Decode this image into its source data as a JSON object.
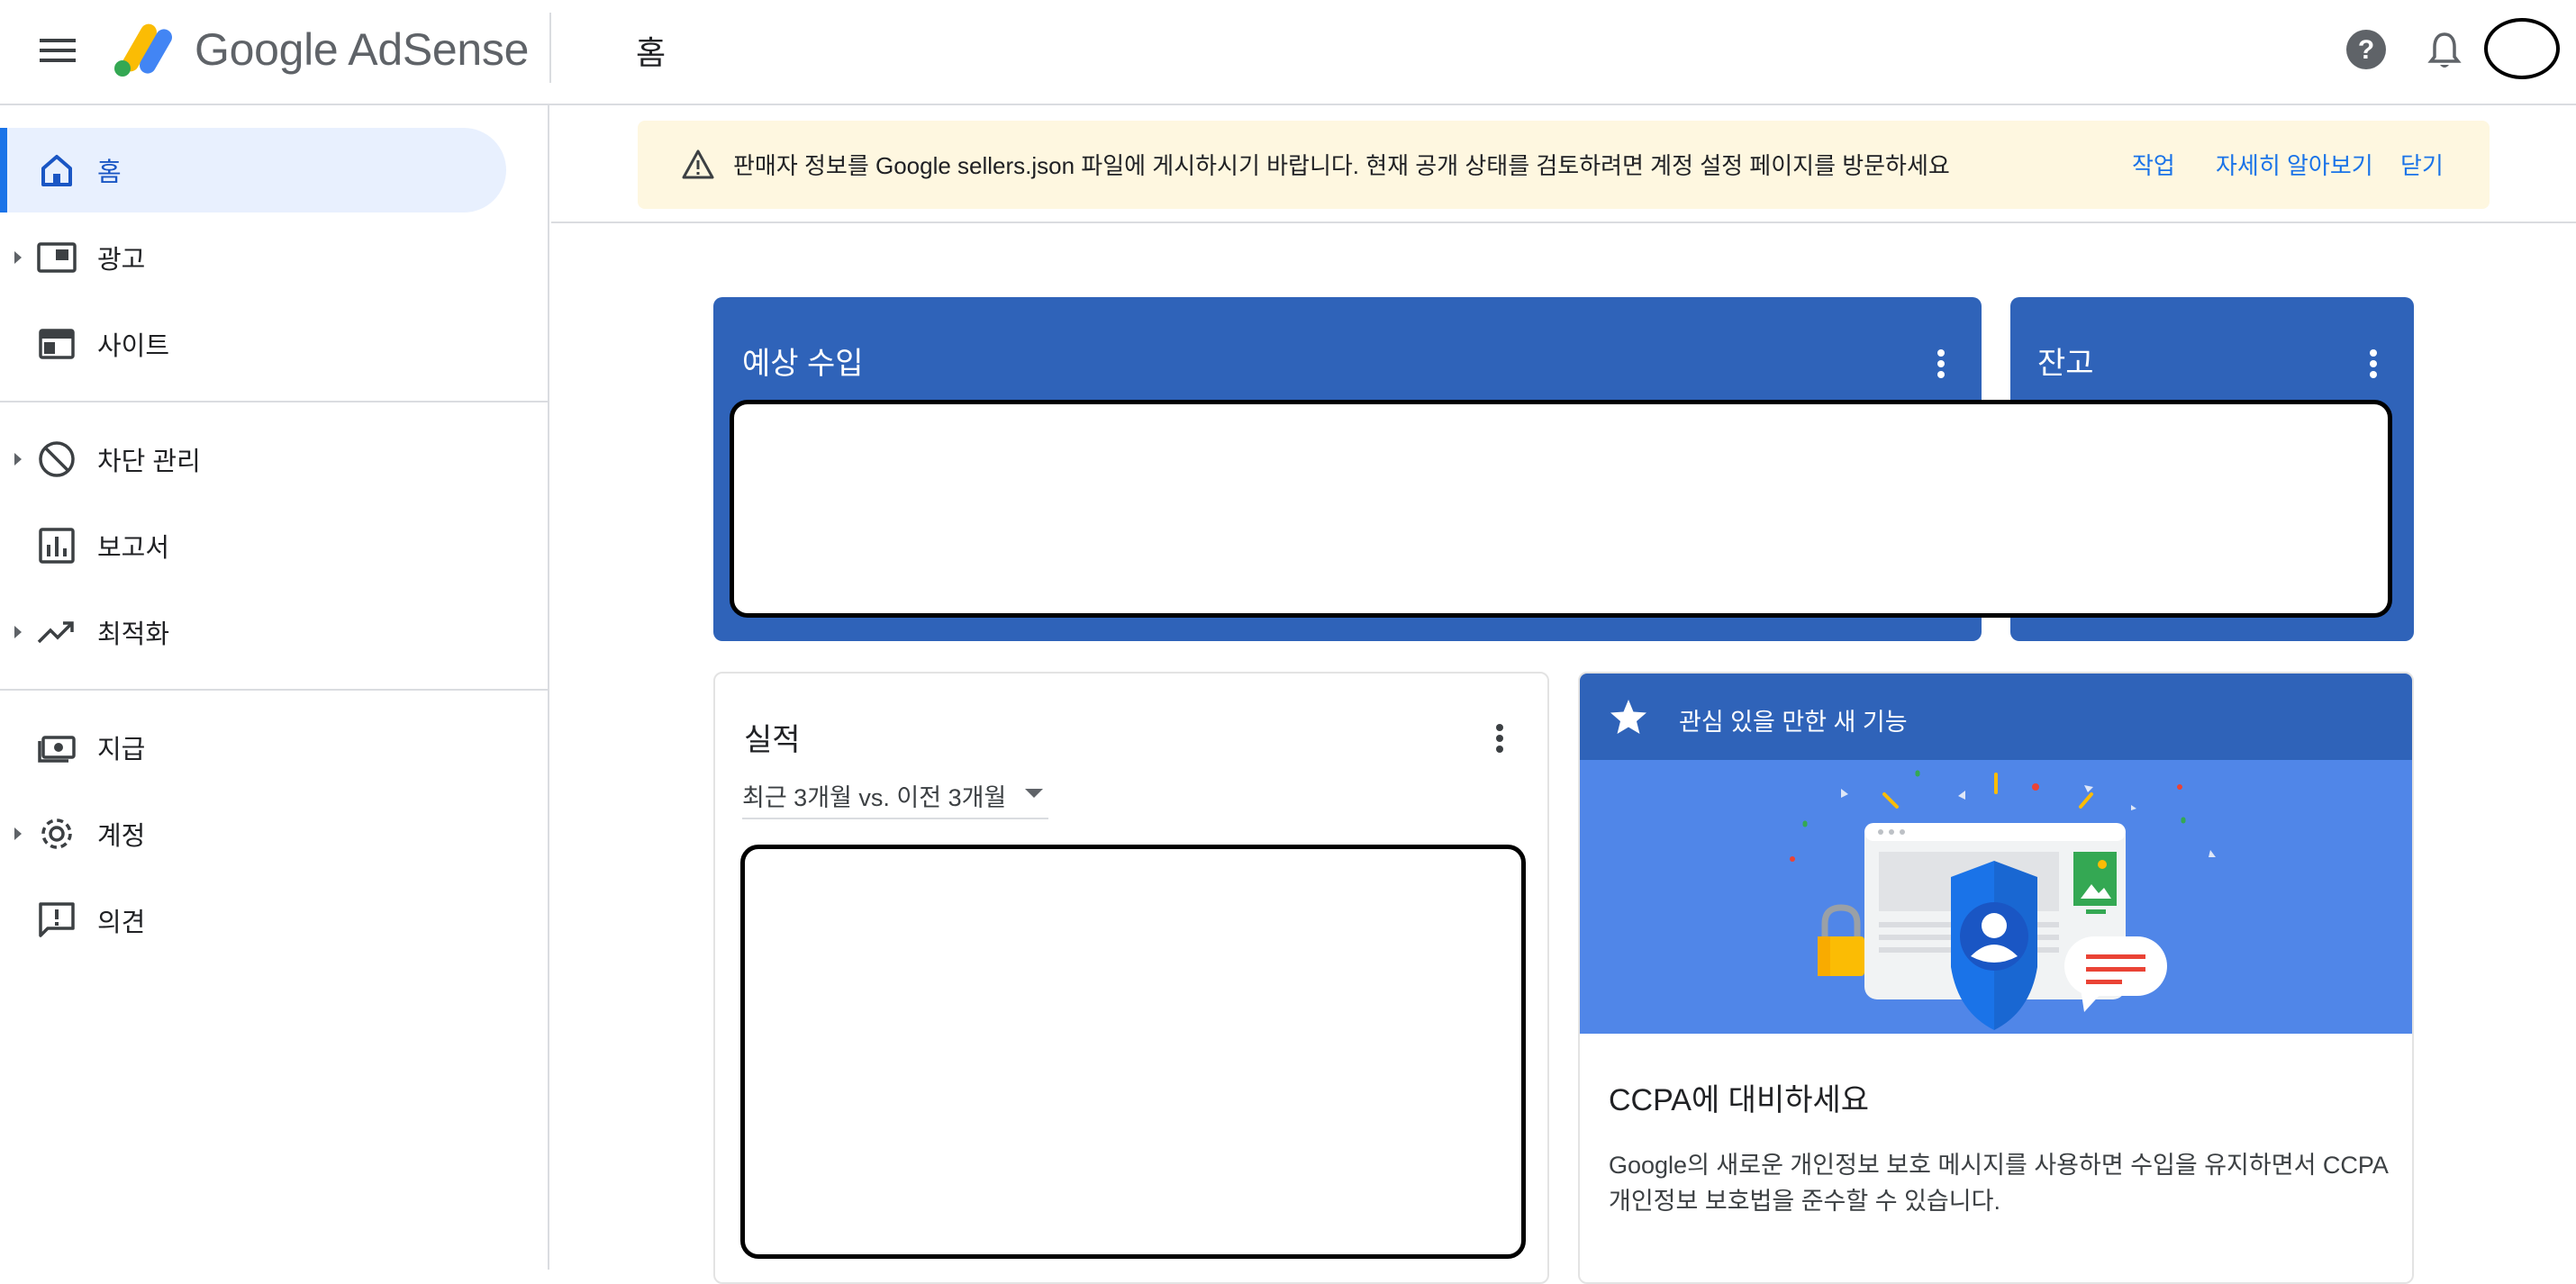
{
  "header": {
    "brand": "Google AdSense",
    "page_title": "홈"
  },
  "sidebar": {
    "items": [
      {
        "label": "홈",
        "icon": "home-icon",
        "active": true
      },
      {
        "label": "광고",
        "icon": "ads-icon",
        "expandable": true
      },
      {
        "label": "사이트",
        "icon": "sites-icon"
      },
      {
        "label": "차단 관리",
        "icon": "block-icon",
        "expandable": true
      },
      {
        "label": "보고서",
        "icon": "reports-icon"
      },
      {
        "label": "최적화",
        "icon": "trending-icon",
        "expandable": true
      },
      {
        "label": "지급",
        "icon": "payments-icon"
      },
      {
        "label": "계정",
        "icon": "gear-icon",
        "expandable": true
      },
      {
        "label": "의견",
        "icon": "feedback-icon"
      }
    ]
  },
  "banner": {
    "message": "판매자 정보를 Google sellers.json 파일에 게시하시기 바랍니다. 현재 공개 상태를 검토하려면 계정 설정 페이지를 방문하세요",
    "action_label": "작업",
    "learn_more_label": "자세히 알아보기",
    "close_label": "닫기",
    "background": "#fef7e0"
  },
  "cards": {
    "estimated_earnings": {
      "title": "예상 수입"
    },
    "balance": {
      "title": "잔고"
    },
    "performance": {
      "title": "실적",
      "range_selected": "최근 3개월 vs. 이전 3개월"
    },
    "new_feature": {
      "header": "관심 있을 만한 새 기능",
      "title": "CCPA에 대비하세요",
      "description": "Google의 새로운 개인정보 보호 메시지를 사용하면 수입을 유지하면서 CCPA 개인정보 보호법을 준수할 수 있습니다."
    }
  },
  "colors": {
    "accent": "#1a73e8",
    "card_blue": "#2f63b9",
    "illustration_blue": "#5086e8"
  }
}
